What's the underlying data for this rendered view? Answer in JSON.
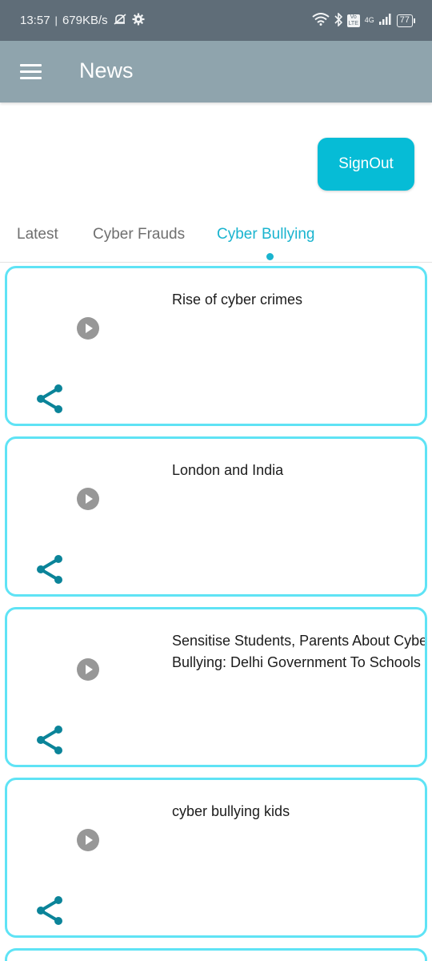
{
  "status_bar": {
    "time": "13:57",
    "separator": "|",
    "speed": "679KB/s",
    "network": "4G",
    "volte": "Vo LTE",
    "battery": "77"
  },
  "app_bar": {
    "title": "News"
  },
  "signout_label": "SignOut",
  "tabs": [
    {
      "label": "Latest",
      "active": false
    },
    {
      "label": "Cyber Frauds",
      "active": false
    },
    {
      "label": "Cyber Bullying",
      "active": true
    }
  ],
  "cards": [
    {
      "title_lines": [
        "Rise of cyber crimes",
        ""
      ]
    },
    {
      "title_lines": [
        "London and India",
        ""
      ]
    },
    {
      "title_lines": [
        "Sensitise Students, Parents About Cyber",
        "Bullying: Delhi Government To Schools"
      ]
    },
    {
      "title_lines": [
        "cyber bullying kids",
        ""
      ]
    }
  ],
  "colors": {
    "status_bar": "#5f6d78",
    "app_bar": "#8fa4ad",
    "accent": "#06bcd6",
    "card_border": "#5fe3f5",
    "share_icon": "#0b8499",
    "play_icon": "#979797"
  }
}
